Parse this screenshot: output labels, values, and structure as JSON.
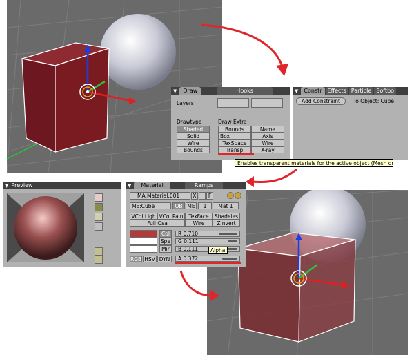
{
  "draw_panel": {
    "tabs": [
      "Draw",
      "Hooks"
    ],
    "layers_label": "Layers",
    "drawtype_label": "Drawtype",
    "drawtype_options": [
      "Shaded",
      "Solid",
      "Wire",
      "Bounds"
    ],
    "draw_extra_label": "Draw Extra",
    "draw_extra_left": [
      "Bounds",
      "Box",
      "TexSpace",
      "Transp"
    ],
    "draw_extra_right": [
      "Name",
      "Axis",
      "Wire",
      "X-ray"
    ],
    "tooltip": "Enables transparent materials for the active object (Mesh only)"
  },
  "constraints_panel": {
    "tabs": [
      "Constr",
      "Effects",
      "Particle",
      "Softbo"
    ],
    "add_constraint": "Add Constraint",
    "to_object": "To Object: Cube"
  },
  "preview_panel": {
    "title": "Preview"
  },
  "material_panel": {
    "tabs": [
      "Material",
      "Ramps"
    ],
    "material_name": "MA:Material.001",
    "x_btn": "X",
    "f_btn": "F",
    "mesh_name": "ME:Cube",
    "ob_btn": "OB",
    "me_btn": "ME",
    "mat_index": "1",
    "mat_count": "Mat 1",
    "row1": [
      "VCol Ligh",
      "VCol Pain",
      "TexFace",
      "Shadeles"
    ],
    "row2": [
      "Full Osa",
      "Wire",
      "ZInvert"
    ],
    "color_labels": [
      "Col",
      "Spe",
      "Mir"
    ],
    "sliders": [
      {
        "text": "R 0.710",
        "fraction": 0.71
      },
      {
        "text": "G 0.111",
        "fraction": 0.111
      },
      {
        "text": "B 0.111",
        "fraction": 0.111
      }
    ],
    "alpha_slider": {
      "text": "A 0.372",
      "fraction": 0.372
    },
    "alpha_tooltip": "Alpha",
    "modes": [
      "RGB",
      "HSV",
      "DYN"
    ],
    "colors": {
      "col": "#b33a3a",
      "spe": "#ffffff",
      "mir": "#ffffff"
    }
  },
  "colors": {
    "viewport_bg": "#676767",
    "cube_fill": "#7a1b22",
    "arrow": "#e0262b",
    "axis_z": "#1a3fe0",
    "axis_x": "#e02020",
    "axis_y": "#2ec23a"
  }
}
